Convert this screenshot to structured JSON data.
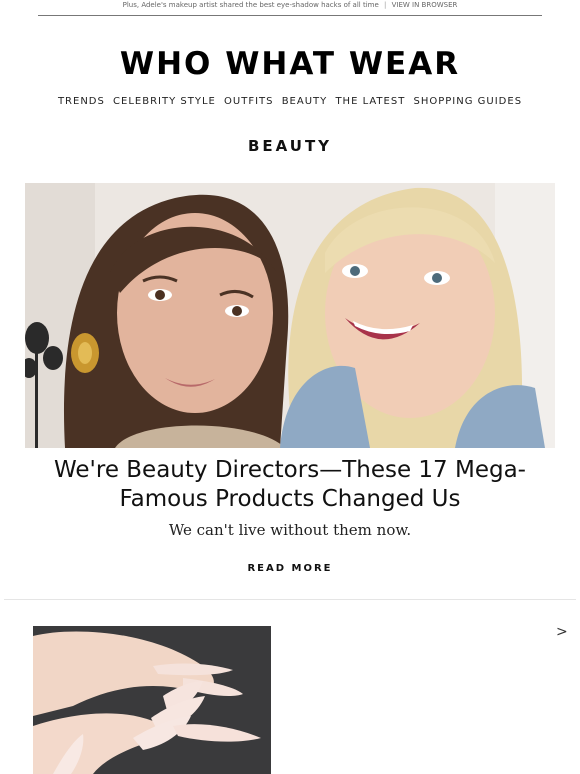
{
  "preheader": {
    "text": "Plus, Adele's makeup artist shared the best eye-shadow hacks of all time",
    "separator": "|",
    "view_in_browser": "VIEW IN BROWSER"
  },
  "brand": {
    "logo_text": "WHO WHAT WEAR"
  },
  "nav": {
    "items": [
      "TRENDS",
      "CELEBRITY STYLE",
      "OUTFITS",
      "BEAUTY",
      "THE LATEST",
      "SHOPPING GUIDES"
    ]
  },
  "section": {
    "title": "BEAUTY"
  },
  "feature": {
    "image_icon": "photo-two-women-selfie",
    "headline": "We're Beauty Directors—These 17 Mega-Famous Products Changed Us",
    "dek": "We can't live without them now.",
    "cta": "READ MORE"
  },
  "carousel": {
    "image_icon": "photo-manicured-almond-nails",
    "next_label": ">"
  },
  "colors": {
    "text": "#111111",
    "rule": "#777777",
    "divider": "#e5e5e5"
  }
}
